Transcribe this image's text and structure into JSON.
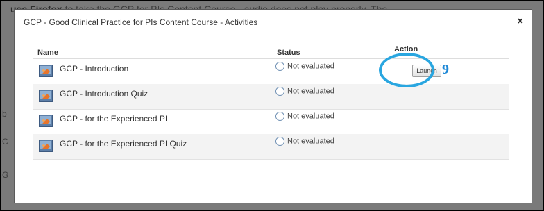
{
  "background": {
    "line1_bold": "use Firefox",
    "line1_rest": " to take the GCP for PIs Content Course - audio does not play properly. The",
    "frag_a": "b",
    "frag_b": "C",
    "frag_c": "G"
  },
  "modal": {
    "title": "GCP - Good Clinical Practice for PIs Content Course - Activities",
    "close_symbol": "×"
  },
  "table": {
    "headers": {
      "name": "Name",
      "status": "Status",
      "action": "Action"
    },
    "rows": [
      {
        "name": "GCP - Introduction",
        "status": "Not evaluated",
        "action": "Launch"
      },
      {
        "name": "GCP - Introduction Quiz",
        "status": "Not evaluated",
        "action": ""
      },
      {
        "name": "GCP - for the Experienced PI",
        "status": "Not evaluated",
        "action": ""
      },
      {
        "name": "GCP - for the Experienced PI Quiz",
        "status": "Not evaluated",
        "action": ""
      }
    ]
  },
  "annotation": {
    "number": "9",
    "color": "#29a6e0"
  }
}
